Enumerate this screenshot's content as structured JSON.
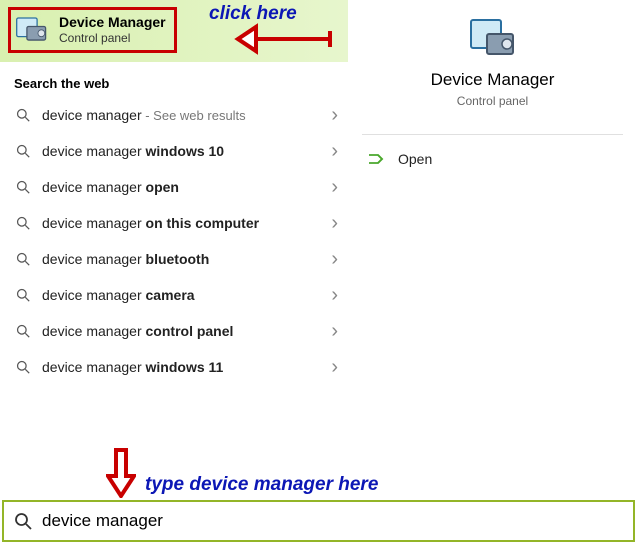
{
  "annotations": {
    "click_here": "click here",
    "type_here": "type device manager here"
  },
  "best_match": {
    "title": "Device Manager",
    "subtitle": "Control panel"
  },
  "section_label": "Search the web",
  "suggestions": [
    {
      "prefix": "device manager",
      "bold": "",
      "hint": " - See web results"
    },
    {
      "prefix": "device manager ",
      "bold": "windows 10",
      "hint": ""
    },
    {
      "prefix": "device manager ",
      "bold": "open",
      "hint": ""
    },
    {
      "prefix": "device manager ",
      "bold": "on this computer",
      "hint": ""
    },
    {
      "prefix": "device manager ",
      "bold": "bluetooth",
      "hint": ""
    },
    {
      "prefix": "device manager ",
      "bold": "camera",
      "hint": ""
    },
    {
      "prefix": "device manager ",
      "bold": "control panel",
      "hint": ""
    },
    {
      "prefix": "device manager ",
      "bold": "windows 11",
      "hint": ""
    }
  ],
  "detail": {
    "title": "Device Manager",
    "subtitle": "Control panel",
    "open_label": "Open"
  },
  "search": {
    "value": "device manager",
    "placeholder": ""
  }
}
